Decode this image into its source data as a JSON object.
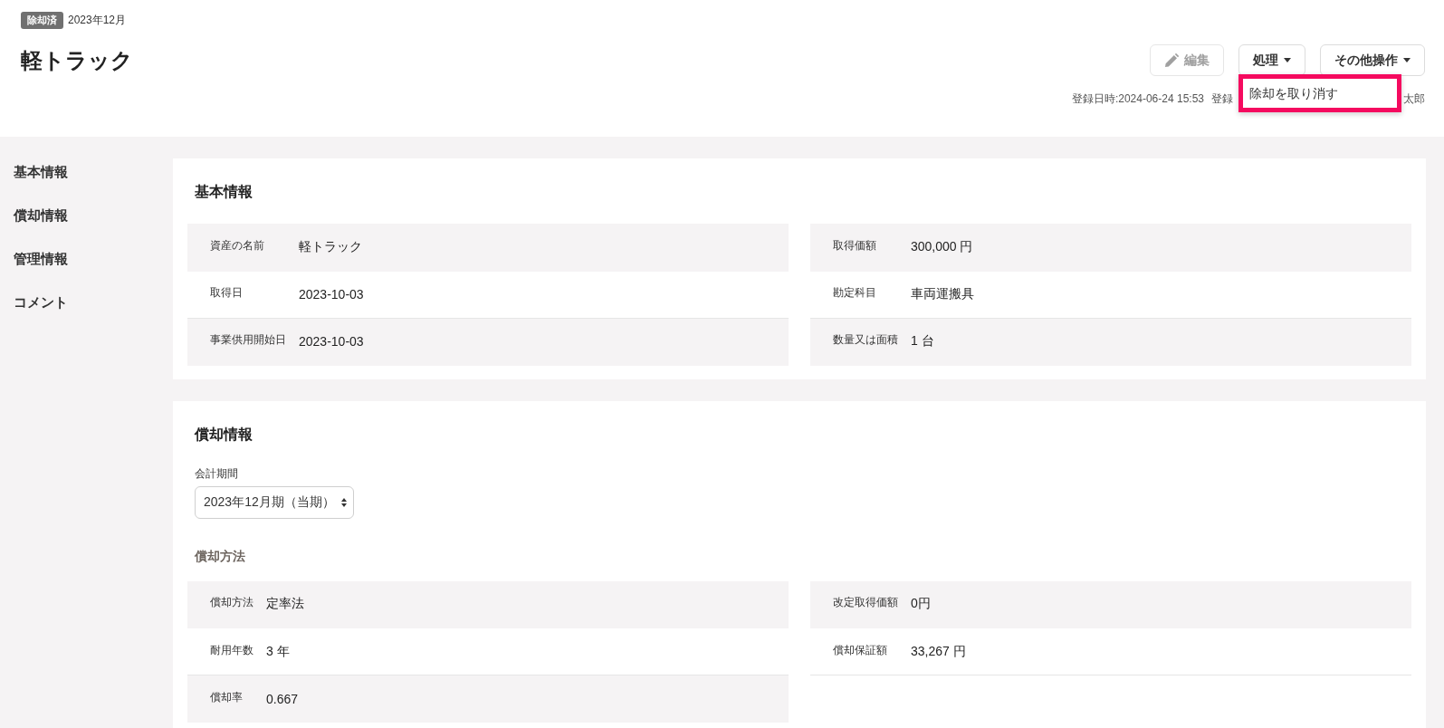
{
  "header": {
    "status_badge": "除却済",
    "period": "2023年12月",
    "title": "軽トラック",
    "buttons": [
      {
        "kind": "edit",
        "label": "編集",
        "disabled": true
      },
      {
        "kind": "dropdown",
        "label": "処理",
        "disabled": false,
        "menu": {
          "highlighted": true,
          "items": [
            {
              "label": "除却を取り消す"
            }
          ]
        }
      },
      {
        "kind": "dropdown",
        "label": "その他操作",
        "disabled": false
      }
    ],
    "meta": [
      "登録日時:2024-06-24 15:53",
      "登録",
      "太郎"
    ]
  },
  "sidebar": {
    "items": [
      {
        "label": "基本情報"
      },
      {
        "label": "償却情報"
      },
      {
        "label": "管理情報"
      },
      {
        "label": "コメント"
      }
    ]
  },
  "sections": [
    {
      "title": "基本情報",
      "columns": [
        [
          {
            "label": "資産の名前",
            "value": "軽トラック"
          },
          {
            "label": "取得日",
            "value": "2023-10-03"
          },
          {
            "label": "事業供用開始日",
            "value": "2023-10-03"
          }
        ],
        [
          {
            "label": "取得価額",
            "value": "300,000 円"
          },
          {
            "label": "勘定科目",
            "value": "車両運搬具"
          },
          {
            "label": "数量又は面積",
            "value": "1 台"
          }
        ]
      ]
    },
    {
      "title": "償却情報",
      "period_field": {
        "label": "会計期間",
        "value": "2023年12月期（当期）"
      },
      "subheading": "償却方法",
      "columns": [
        [
          {
            "label": "償却方法",
            "value": "定率法"
          },
          {
            "label": "耐用年数",
            "value": "3 年"
          },
          {
            "label": "償却率",
            "value": "0.667"
          }
        ],
        [
          {
            "label": "改定取得価額",
            "value": "0円"
          },
          {
            "label": "償却保証額",
            "value": "33,267 円"
          }
        ]
      ]
    }
  ]
}
